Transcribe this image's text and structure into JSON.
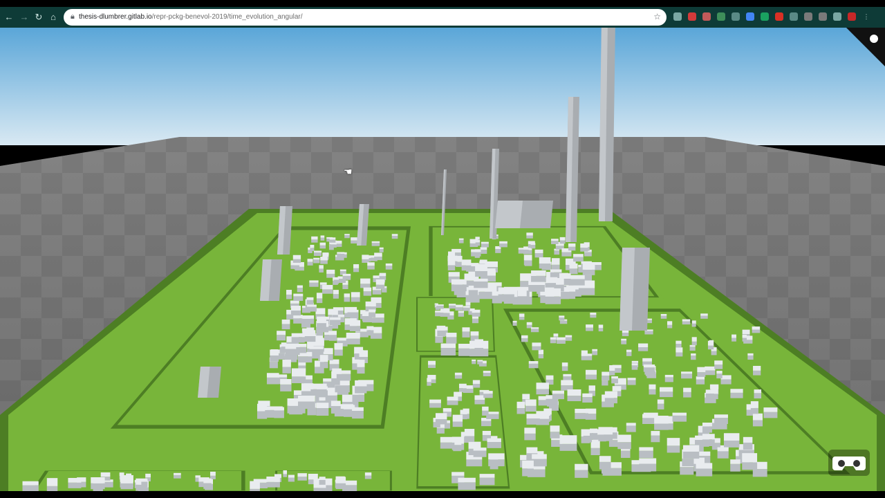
{
  "browser": {
    "url_host": "thesis-dlumbrer.gitlab.io",
    "url_path": "/repr-pckg-benevol-2019/time_evolution_angular/",
    "nav_icons": [
      "back-icon",
      "forward-icon",
      "reload-icon",
      "home-icon"
    ],
    "extensions": [
      {
        "name": "ext-chat-icon",
        "color": "#7aa7a3"
      },
      {
        "name": "ext-red-icon",
        "color": "#d23a3a"
      },
      {
        "name": "ext-pin-icon",
        "color": "#c15a5a"
      },
      {
        "name": "ext-dropper-icon",
        "color": "#3e8e5a"
      },
      {
        "name": "ext-puzzle-icon",
        "color": "#5a8a86"
      },
      {
        "name": "ext-circle-icon",
        "color": "#4285f4"
      },
      {
        "name": "ext-green-icon",
        "color": "#1aa260"
      },
      {
        "name": "ext-gmail-icon",
        "color": "#d93025"
      },
      {
        "name": "ext-arrow-icon",
        "color": "#5a8a86"
      },
      {
        "name": "ext-w-icon",
        "color": "#7a7a7a"
      },
      {
        "name": "ext-shield-icon",
        "color": "#7a7a7a"
      },
      {
        "name": "ext-v-icon",
        "color": "#7aa7a3"
      },
      {
        "name": "ext-avatar-icon",
        "color": "#c62828"
      },
      {
        "name": "menu-icon",
        "color": "#0e3b37"
      }
    ]
  },
  "scene": {
    "colors": {
      "sky_top": "#5aa6d8",
      "sky_bottom": "#d9e9f3",
      "ground_dark": "#6c6c6c",
      "ground_light": "#858585",
      "district_green": "#78b53a",
      "district_dark": "#4d7e24",
      "building": "#e9ecef",
      "building_shadow": "#b9bec3"
    },
    "vr_icon": "vr-goggles-icon"
  }
}
